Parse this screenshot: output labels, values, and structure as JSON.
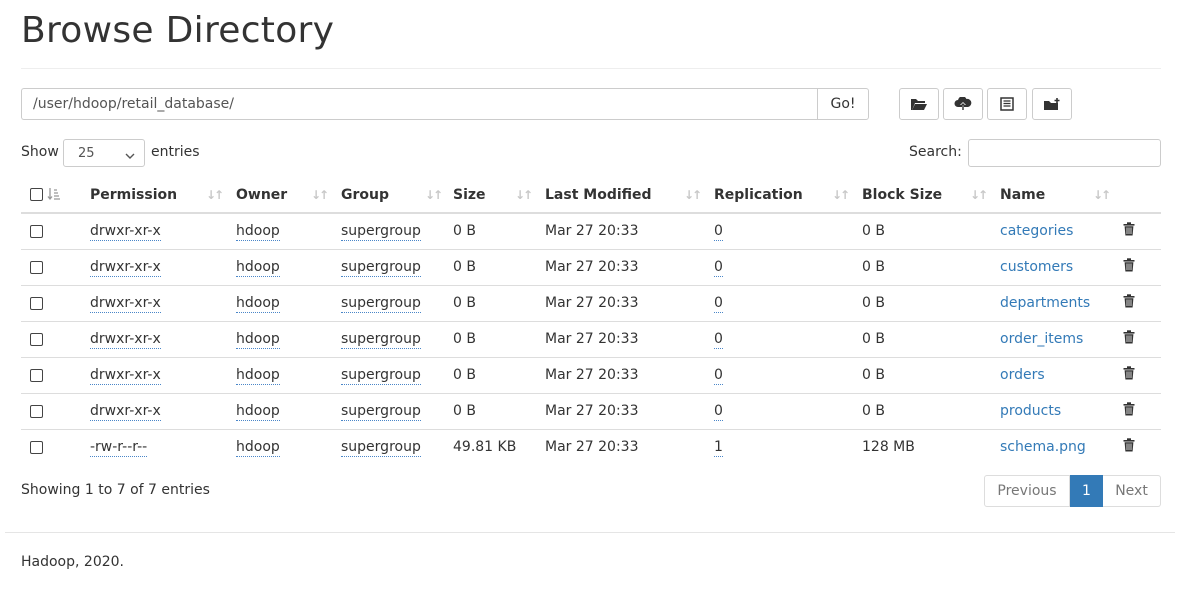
{
  "page": {
    "title": "Browse Directory"
  },
  "path_bar": {
    "value": "/user/hdoop/retail_database/",
    "go_label": "Go!"
  },
  "toolbar": {
    "icons": [
      "folder-open-icon",
      "cloud-upload-icon",
      "list-icon",
      "folder-add-icon"
    ]
  },
  "controls": {
    "show_label": "Show",
    "entries_value": "25",
    "entries_label": "entries",
    "search_label": "Search:"
  },
  "table": {
    "headers": [
      "Permission",
      "Owner",
      "Group",
      "Size",
      "Last Modified",
      "Replication",
      "Block Size",
      "Name"
    ],
    "rows": [
      {
        "permission": "drwxr-xr-x",
        "owner": "hdoop",
        "group": "supergroup",
        "size": "0 B",
        "modified": "Mar 27 20:33",
        "replication": "0",
        "block_size": "0 B",
        "name": "categories"
      },
      {
        "permission": "drwxr-xr-x",
        "owner": "hdoop",
        "group": "supergroup",
        "size": "0 B",
        "modified": "Mar 27 20:33",
        "replication": "0",
        "block_size": "0 B",
        "name": "customers"
      },
      {
        "permission": "drwxr-xr-x",
        "owner": "hdoop",
        "group": "supergroup",
        "size": "0 B",
        "modified": "Mar 27 20:33",
        "replication": "0",
        "block_size": "0 B",
        "name": "departments"
      },
      {
        "permission": "drwxr-xr-x",
        "owner": "hdoop",
        "group": "supergroup",
        "size": "0 B",
        "modified": "Mar 27 20:33",
        "replication": "0",
        "block_size": "0 B",
        "name": "order_items"
      },
      {
        "permission": "drwxr-xr-x",
        "owner": "hdoop",
        "group": "supergroup",
        "size": "0 B",
        "modified": "Mar 27 20:33",
        "replication": "0",
        "block_size": "0 B",
        "name": "orders"
      },
      {
        "permission": "drwxr-xr-x",
        "owner": "hdoop",
        "group": "supergroup",
        "size": "0 B",
        "modified": "Mar 27 20:33",
        "replication": "0",
        "block_size": "0 B",
        "name": "products"
      },
      {
        "permission": "-rw-r--r--",
        "owner": "hdoop",
        "group": "supergroup",
        "size": "49.81 KB",
        "modified": "Mar 27 20:33",
        "replication": "1",
        "block_size": "128 MB",
        "name": "schema.png"
      }
    ]
  },
  "pagination": {
    "info": "Showing 1 to 7 of 7 entries",
    "previous": "Previous",
    "current": "1",
    "next": "Next"
  },
  "footer": {
    "text": "Hadoop, 2020."
  },
  "colors": {
    "link": "#337ab7",
    "active_page": "#337ab7",
    "border": "#dddddd"
  }
}
